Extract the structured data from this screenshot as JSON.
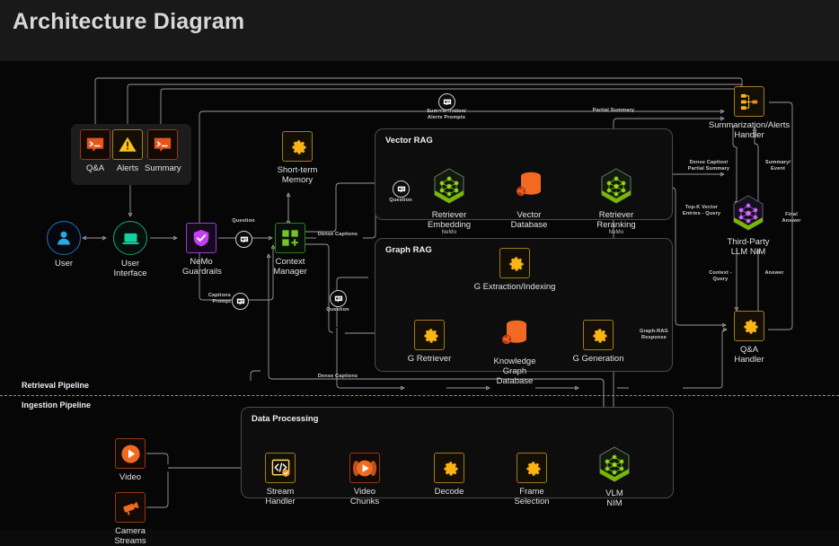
{
  "header": {
    "title": "Architecture Diagram"
  },
  "pipelines": {
    "retrieval_label": "Retrieval Pipeline",
    "ingestion_label": "Ingestion Pipeline"
  },
  "groups": {
    "vector_rag": "Vector RAG",
    "graph_rag": "Graph RAG",
    "data_processing": "Data Processing"
  },
  "nodes": {
    "qa": {
      "label": "Q&A",
      "icon": "terminal-icon"
    },
    "alerts": {
      "label": "Alerts",
      "icon": "warning-triangle-icon"
    },
    "summary": {
      "label": "Summary",
      "icon": "terminal-icon"
    },
    "user": {
      "label": "User",
      "icon": "user-avatar-icon"
    },
    "user_interface": {
      "label": "User\nInterface",
      "icon": "laptop-icon"
    },
    "nemo_guardrails": {
      "label": "NeMo\nGuardrails",
      "icon": "shield-check-icon"
    },
    "context_manager": {
      "label": "Context\nManager",
      "icon": "grid-plus-icon"
    },
    "short_term_memory": {
      "label": "Short-term\nMemory",
      "icon": "gear-icon"
    },
    "retriever_embedding": {
      "label": "Retriever\nEmbedding",
      "sub": "NeMo",
      "icon": "nim-hexagon-icon"
    },
    "vector_database": {
      "label": "Vector\nDatabase",
      "icon": "database-icon"
    },
    "retriever_reranking": {
      "label": "Retriever\nReranking",
      "sub": "NeMo",
      "icon": "nim-hexagon-icon"
    },
    "g_extraction_indexing": {
      "label": "G Extraction/Indexing",
      "icon": "gear-icon"
    },
    "g_retriever": {
      "label": "G Retriever",
      "icon": "gear-icon"
    },
    "knowledge_graph_database": {
      "label": "Knowledge Graph\nDatabase",
      "icon": "database-icon"
    },
    "g_generation": {
      "label": "G Generation",
      "icon": "gear-icon"
    },
    "summarization_alerts_handler": {
      "label": "Summarization/Alerts\nHandler",
      "icon": "hierarchy-icon"
    },
    "third_party_llm_nim": {
      "label": "Third-Party\nLLM NIM",
      "icon": "nim-hexagon-icon"
    },
    "qa_handler": {
      "label": "Q&A Handler",
      "icon": "gear-icon"
    },
    "video": {
      "label": "Video",
      "icon": "play-button-icon"
    },
    "camera_streams": {
      "label": "Camera\nStreams",
      "icon": "camera-icon"
    },
    "stream_handler": {
      "label": "Stream\nHandler",
      "icon": "code-check-icon"
    },
    "video_chunks": {
      "label": "Video\nChunks",
      "icon": "video-chunks-icon"
    },
    "decode": {
      "label": "Decode",
      "icon": "gear-icon"
    },
    "frame_selection": {
      "label": "Frame\nSelection",
      "icon": "gear-icon"
    },
    "vlm_nim": {
      "label": "VLM\nNIM",
      "icon": "nim-hexagon-icon"
    }
  },
  "edge_labels": {
    "question_top": "Question",
    "question_vector": "Question",
    "question_graph": "Question",
    "captions_prompt": "Captions\nPrompt",
    "dense_captions_mid": "Dense Captions",
    "dense_captions_bottom": "Dense Captions",
    "summarization_alerts_prompts": "Summarization/\nAlerts Prompts",
    "partial_summary": "Partial Summary",
    "dense_caption_partial_summary": "Dense Caption/\nPartial Summary",
    "summary_event": "Summary/\nEvent",
    "topk_vector_entries_query": "Top-K Vector\nEntries - Query",
    "final_answer": "Final\nAnswer",
    "context_query": "Context -\nQuery",
    "answer": "Answer",
    "graph_rag_response": "Graph-RAG\nResponse"
  },
  "colors": {
    "background": "#060606",
    "header_bg": "#191919",
    "orange": "#f07818",
    "gold": "#fcb415",
    "green": "#76b900",
    "purple": "#b14be0",
    "blue": "#2a9fe0",
    "teal": "#19c79a",
    "wire": "#9a9a9a",
    "divider": "#c7833c"
  }
}
